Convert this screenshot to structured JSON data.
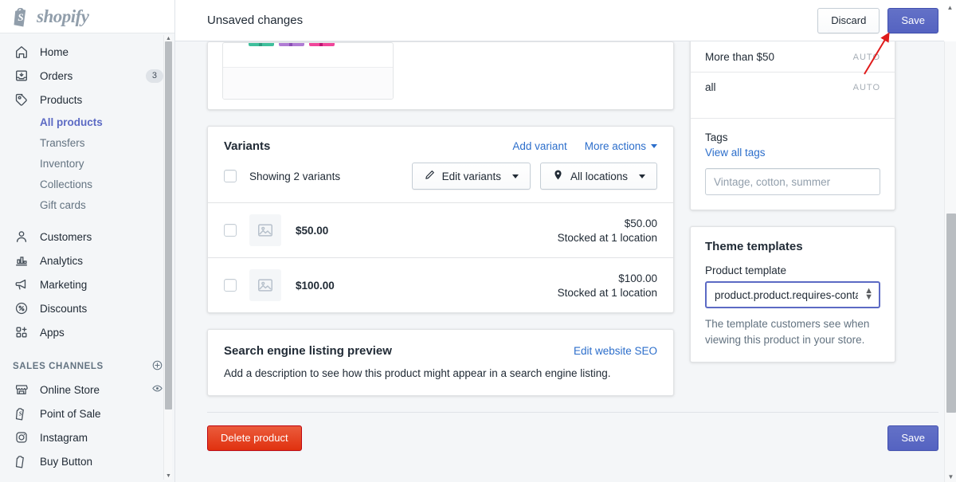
{
  "brand": {
    "logo_text": "shopify",
    "logo_icon": "shopify-bag-icon",
    "accent": "#5c6ac4",
    "link_color": "#2c6ecb",
    "destructive": "#e0310f"
  },
  "sidebar": {
    "items": [
      {
        "label": "Home",
        "icon": "home-icon",
        "badge": ""
      },
      {
        "label": "Orders",
        "icon": "orders-inbox-icon",
        "badge": "3"
      },
      {
        "label": "Products",
        "icon": "products-tag-icon",
        "badge": ""
      }
    ],
    "product_subitems": [
      {
        "label": "All products",
        "active": true
      },
      {
        "label": "Transfers",
        "active": false
      },
      {
        "label": "Inventory",
        "active": false
      },
      {
        "label": "Collections",
        "active": false
      },
      {
        "label": "Gift cards",
        "active": false
      }
    ],
    "items2": [
      {
        "label": "Customers",
        "icon": "customers-person-icon"
      },
      {
        "label": "Analytics",
        "icon": "analytics-bars-icon"
      },
      {
        "label": "Marketing",
        "icon": "marketing-megaphone-icon"
      },
      {
        "label": "Discounts",
        "icon": "discounts-percent-icon"
      },
      {
        "label": "Apps",
        "icon": "apps-grid-plus-icon"
      }
    ],
    "sales_channels_heading": "SALES CHANNELS",
    "sales_channels": [
      {
        "label": "Online Store",
        "icon": "storefront-icon",
        "trailing_icon": "eye-icon"
      },
      {
        "label": "Point of Sale",
        "icon": "pos-icon",
        "trailing_icon": ""
      },
      {
        "label": "Instagram",
        "icon": "instagram-icon",
        "trailing_icon": ""
      },
      {
        "label": "Buy Button",
        "icon": "buy-button-icon",
        "trailing_icon": ""
      }
    ]
  },
  "topbar": {
    "title": "Unsaved changes",
    "discard_label": "Discard",
    "save_label": "Save"
  },
  "variants": {
    "title": "Variants",
    "add_variant_label": "Add variant",
    "more_actions_label": "More actions",
    "showing_label": "Showing 2 variants",
    "edit_variants_label": "Edit variants",
    "all_locations_label": "All locations",
    "rows": [
      {
        "price": "$50.00",
        "amount": "$50.00",
        "stock": "Stocked at 1 location"
      },
      {
        "price": "$100.00",
        "amount": "$100.00",
        "stock": "Stocked at 1 location"
      }
    ]
  },
  "seo": {
    "title": "Search engine listing preview",
    "edit_link": "Edit website SEO",
    "body": "Add a description to see how this product might appear in a search engine listing."
  },
  "collections": {
    "rows": [
      {
        "name": "More than $50",
        "auto": "AUTO"
      },
      {
        "name": "all",
        "auto": "AUTO"
      }
    ]
  },
  "tags": {
    "label": "Tags",
    "view_all_label": "View all tags",
    "input_value": "",
    "input_placeholder": "Vintage, cotton, summer"
  },
  "theme_templates": {
    "title": "Theme templates",
    "field_label": "Product template",
    "selected": "product.product.requires-contact",
    "options": [
      "product.product.requires-contact"
    ],
    "help_text": "The template customers see when viewing this product in your store."
  },
  "footer": {
    "delete_label": "Delete product",
    "save_label": "Save"
  }
}
